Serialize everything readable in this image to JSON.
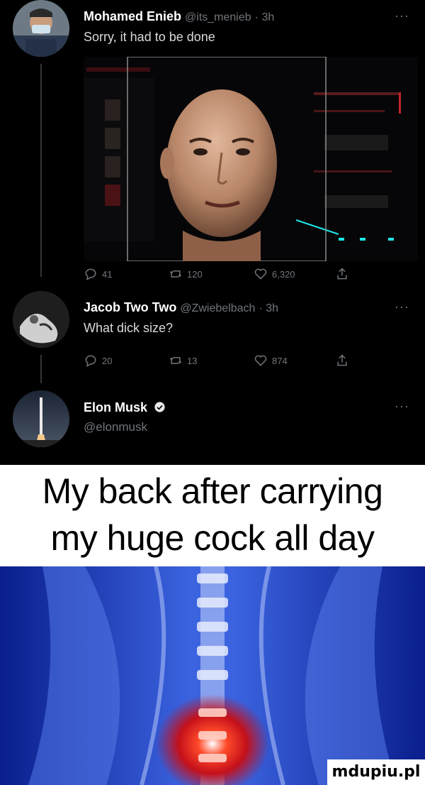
{
  "tweets": [
    {
      "name": "Mohamed Enieb",
      "handle": "@its_menieb",
      "time": "· 3h",
      "text": "Sorry, it had to be done",
      "replies": "41",
      "retweets": "120",
      "likes": "6,320"
    },
    {
      "name": "Jacob Two Two",
      "handle": "@Zwiebelbach",
      "time": "· 3h",
      "text": "What dick size?",
      "replies": "20",
      "retweets": "13",
      "likes": "874"
    },
    {
      "name": "Elon Musk",
      "handle": "@elonmusk",
      "verified": true
    }
  ],
  "more_label": "···",
  "meme": {
    "line1": "My back after carrying",
    "line2": "my huge cock all day"
  },
  "watermark": "mdupiu.pl",
  "colors": {
    "background": "#000000",
    "muted": "#71767b",
    "meme_blue": "#0b2fb8"
  }
}
